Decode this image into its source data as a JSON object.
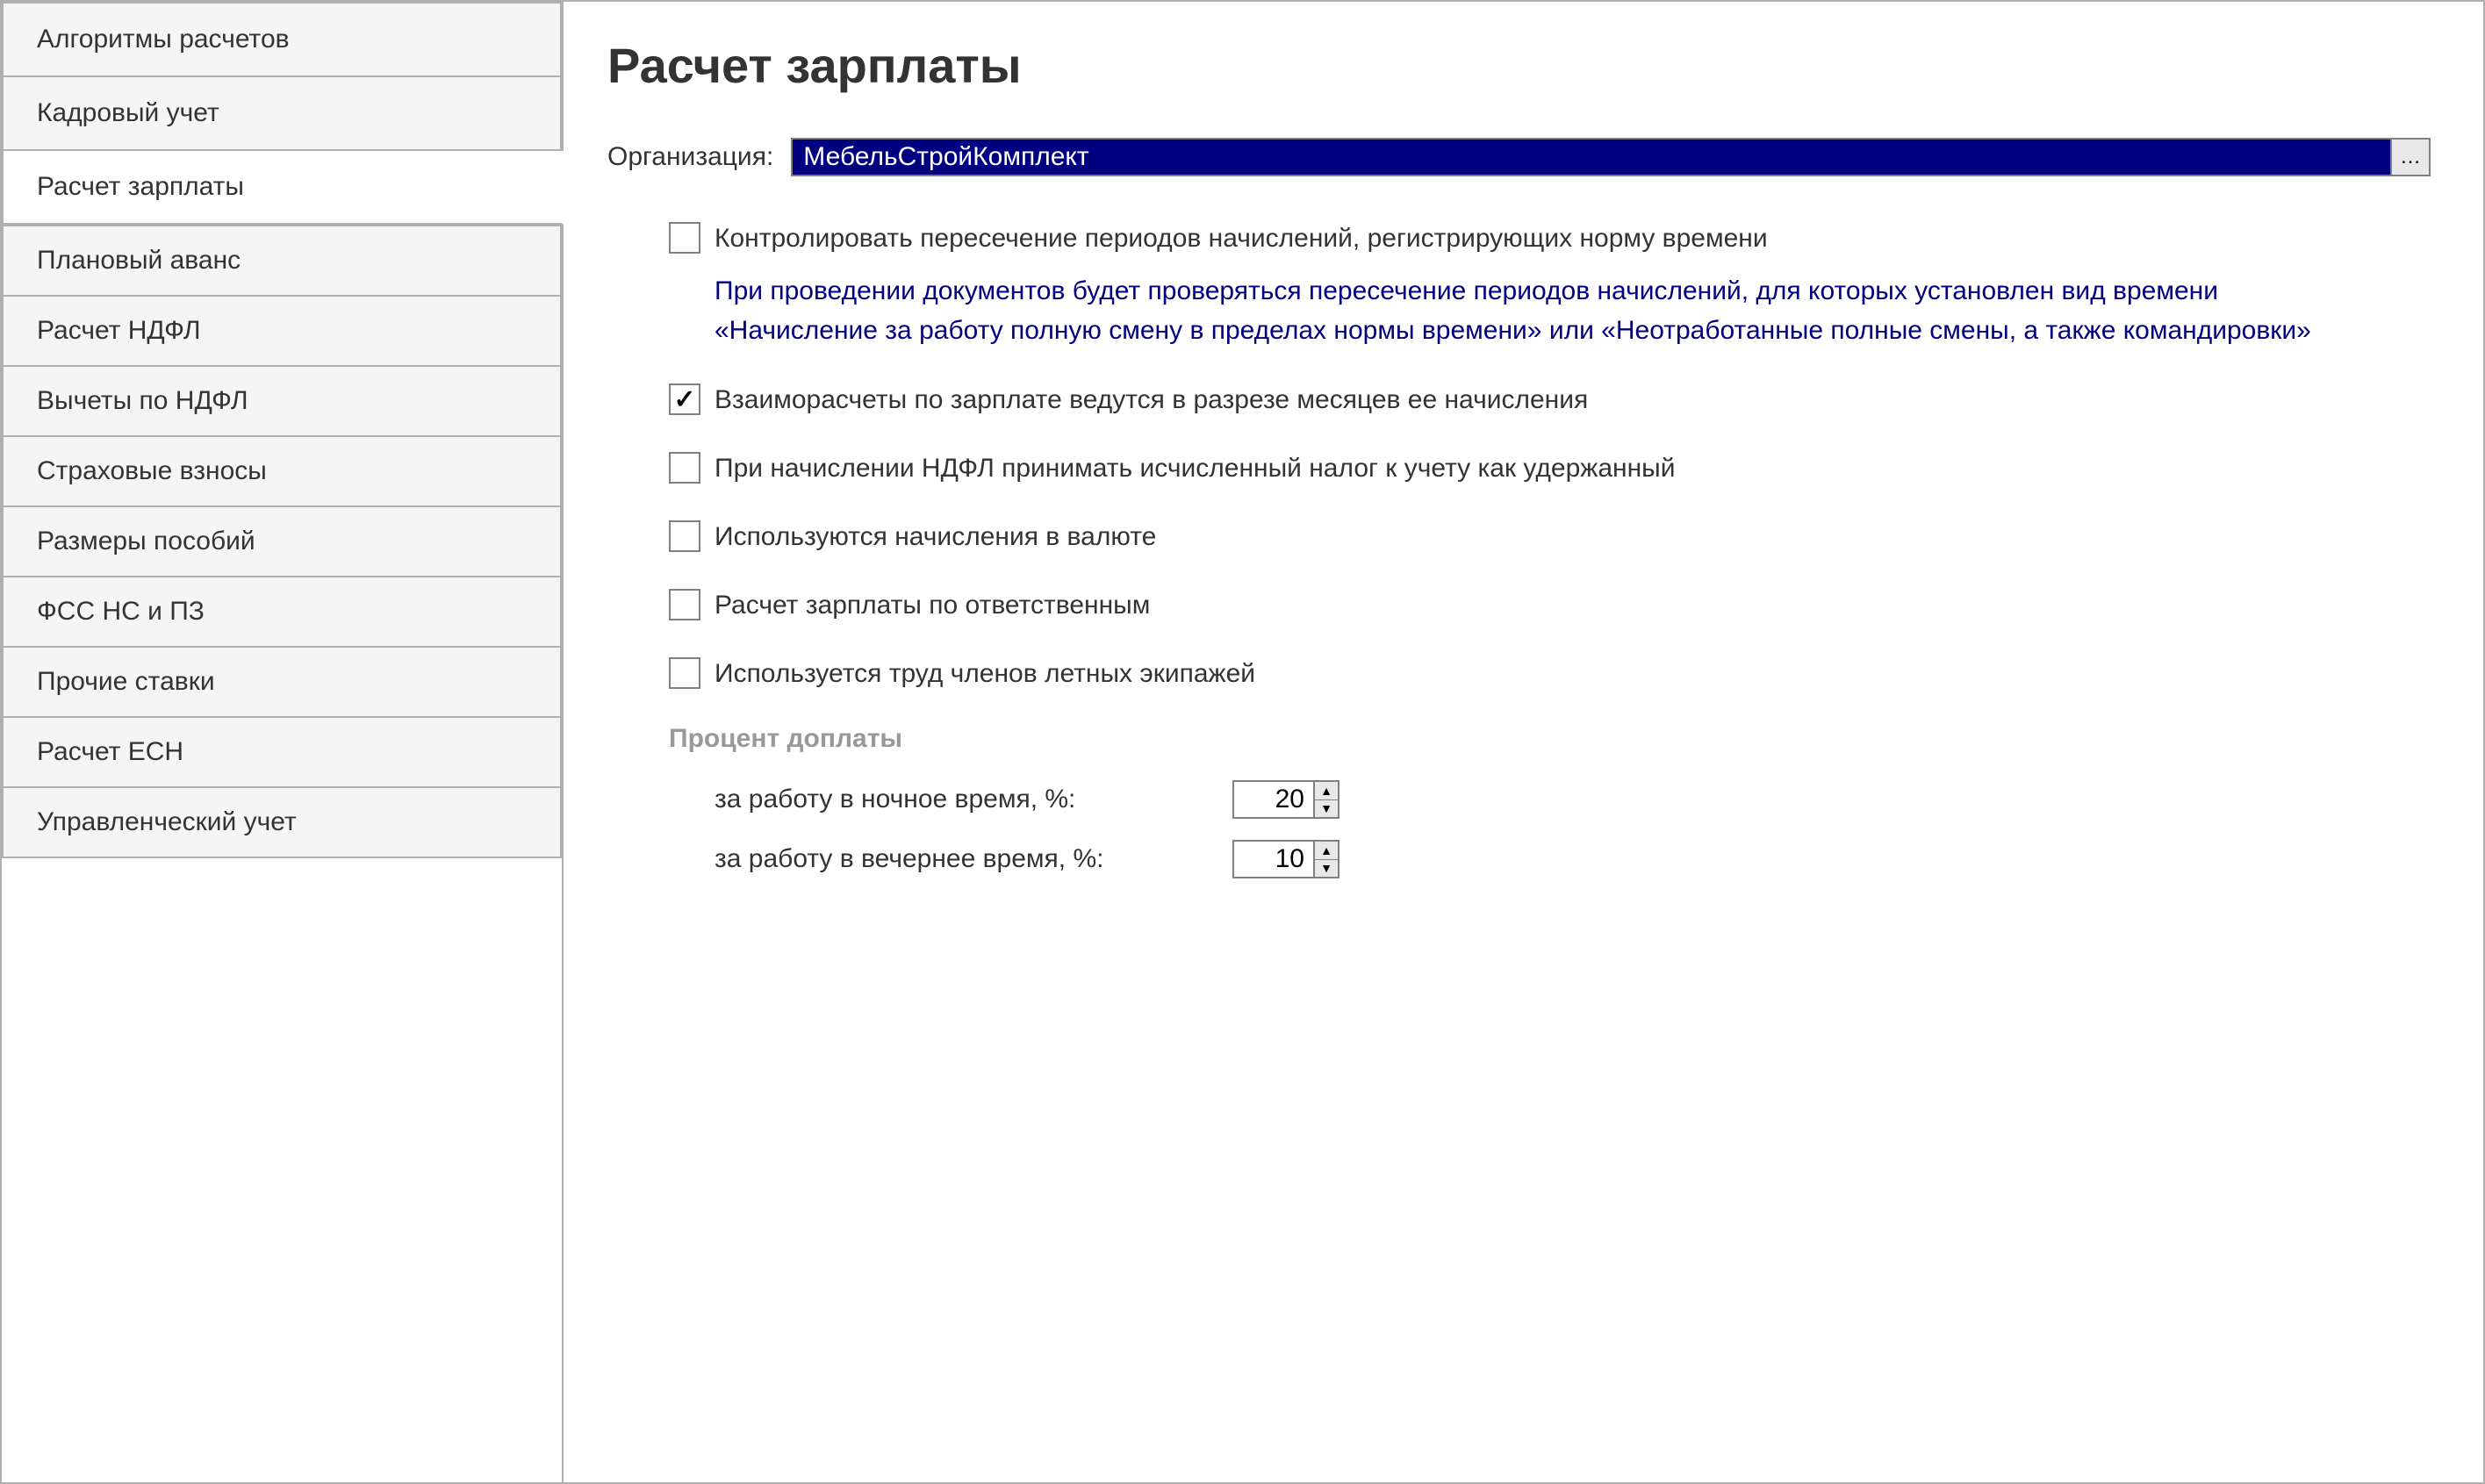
{
  "sidebar": {
    "top_tabs": [
      {
        "label": "Алгоритмы расчетов",
        "active": false
      },
      {
        "label": "Кадровый учет",
        "active": false
      },
      {
        "label": "Расчет зарплаты",
        "active": true
      }
    ],
    "bottom_tabs": [
      {
        "label": "Плановый аванс"
      },
      {
        "label": "Расчет НДФЛ"
      },
      {
        "label": "Вычеты по НДФЛ"
      },
      {
        "label": "Страховые взносы"
      },
      {
        "label": "Размеры пособий"
      },
      {
        "label": "ФСС НС и ПЗ"
      },
      {
        "label": "Прочие ставки"
      },
      {
        "label": "Расчет ЕСН"
      },
      {
        "label": "Управленческий учет"
      }
    ]
  },
  "main": {
    "title": "Расчет зарплаты",
    "org_label": "Организация:",
    "org_value": "МебельСтройКомплект",
    "checkboxes": [
      {
        "label": "Контролировать пересечение периодов начислений, регистрирующих норму времени",
        "checked": false,
        "help": "При проведении документов будет проверяться пересечение периодов начислений, для которых установлен вид времени «Начисление за работу полную смену в пределах нормы времени» или «Неотработанные полные смены, а также командировки»"
      },
      {
        "label": "Взаиморасчеты по зарплате ведутся в разрезе месяцев ее начисления",
        "checked": true
      },
      {
        "label": "При начислении НДФЛ принимать исчисленный налог к учету как удержанный",
        "checked": false
      },
      {
        "label": "Используются начисления в валюте",
        "checked": false
      },
      {
        "label": "Расчет зарплаты по ответственным",
        "checked": false
      },
      {
        "label": "Используется труд членов летных экипажей",
        "checked": false
      }
    ],
    "percent_section": {
      "header": "Процент доплаты",
      "rows": [
        {
          "label": "за работу в ночное время, %:",
          "value": "20"
        },
        {
          "label": "за работу в вечернее время, %:",
          "value": "10"
        }
      ]
    }
  }
}
